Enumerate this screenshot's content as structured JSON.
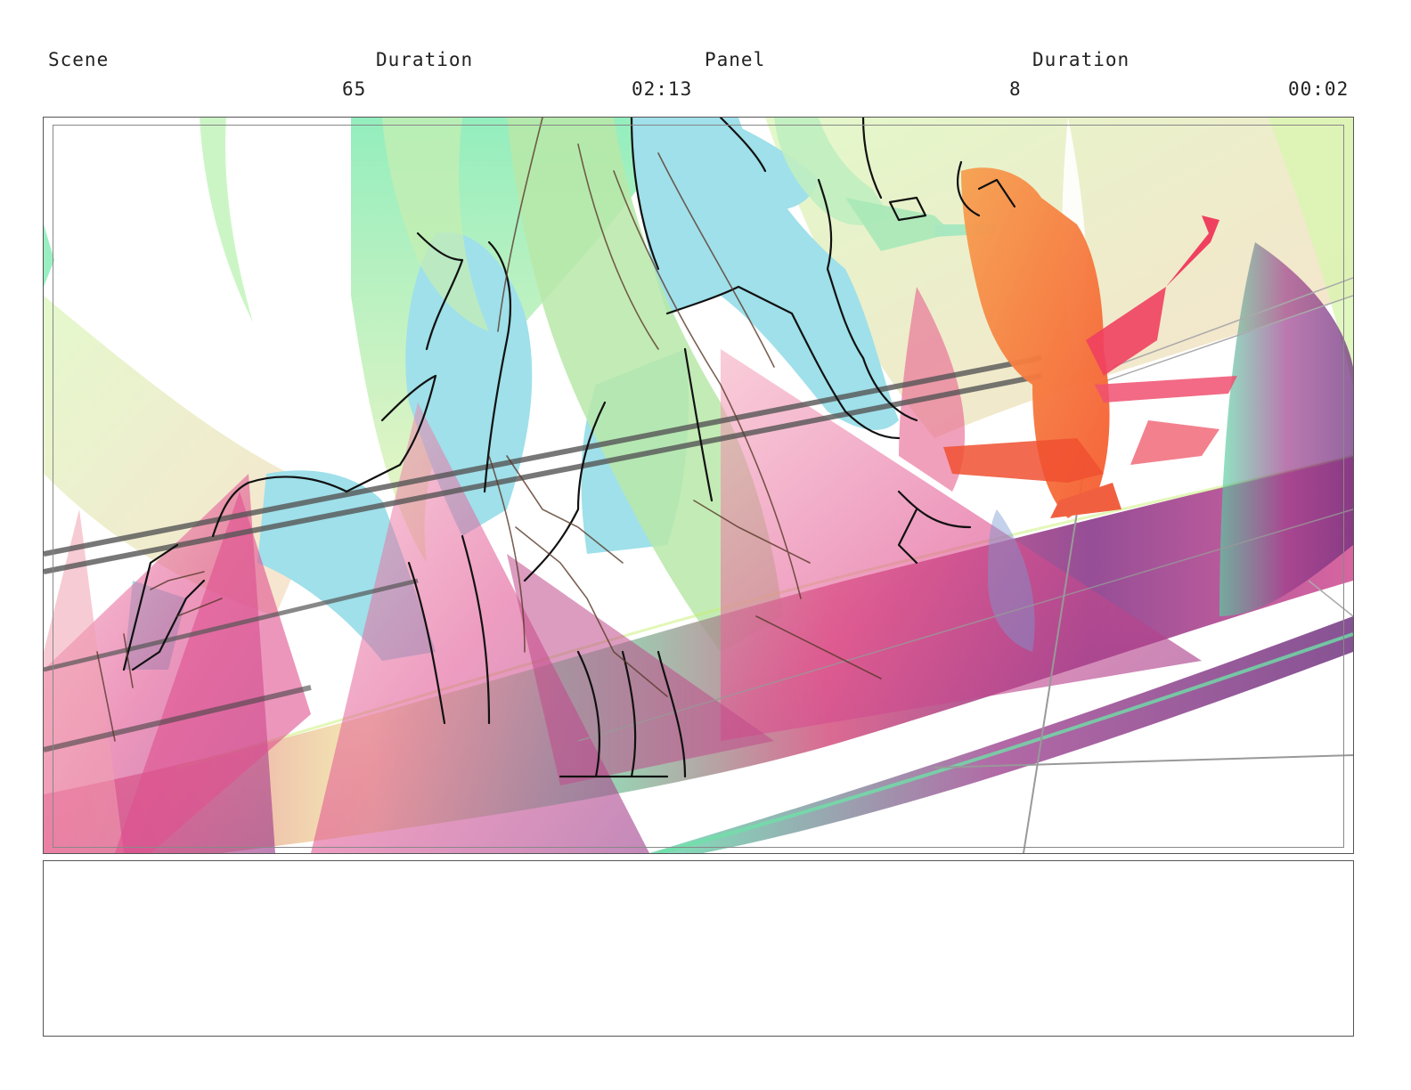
{
  "header": {
    "scene_label": "Scene",
    "duration_label_1": "Duration",
    "panel_label": "Panel",
    "duration_label_2": "Duration",
    "scene_value": "65",
    "scene_duration": "02:13",
    "panel_value": "8",
    "panel_duration": "00:02"
  },
  "colors": {
    "cyan": "#9fe0ea",
    "green": "#8fe8b0",
    "lime": "#d9f5b0",
    "pink": "#e0508f",
    "magenta": "#b03a8a",
    "purple": "#7a3a8a",
    "orange": "#f7803a",
    "red": "#f04060",
    "line": "#111111"
  }
}
